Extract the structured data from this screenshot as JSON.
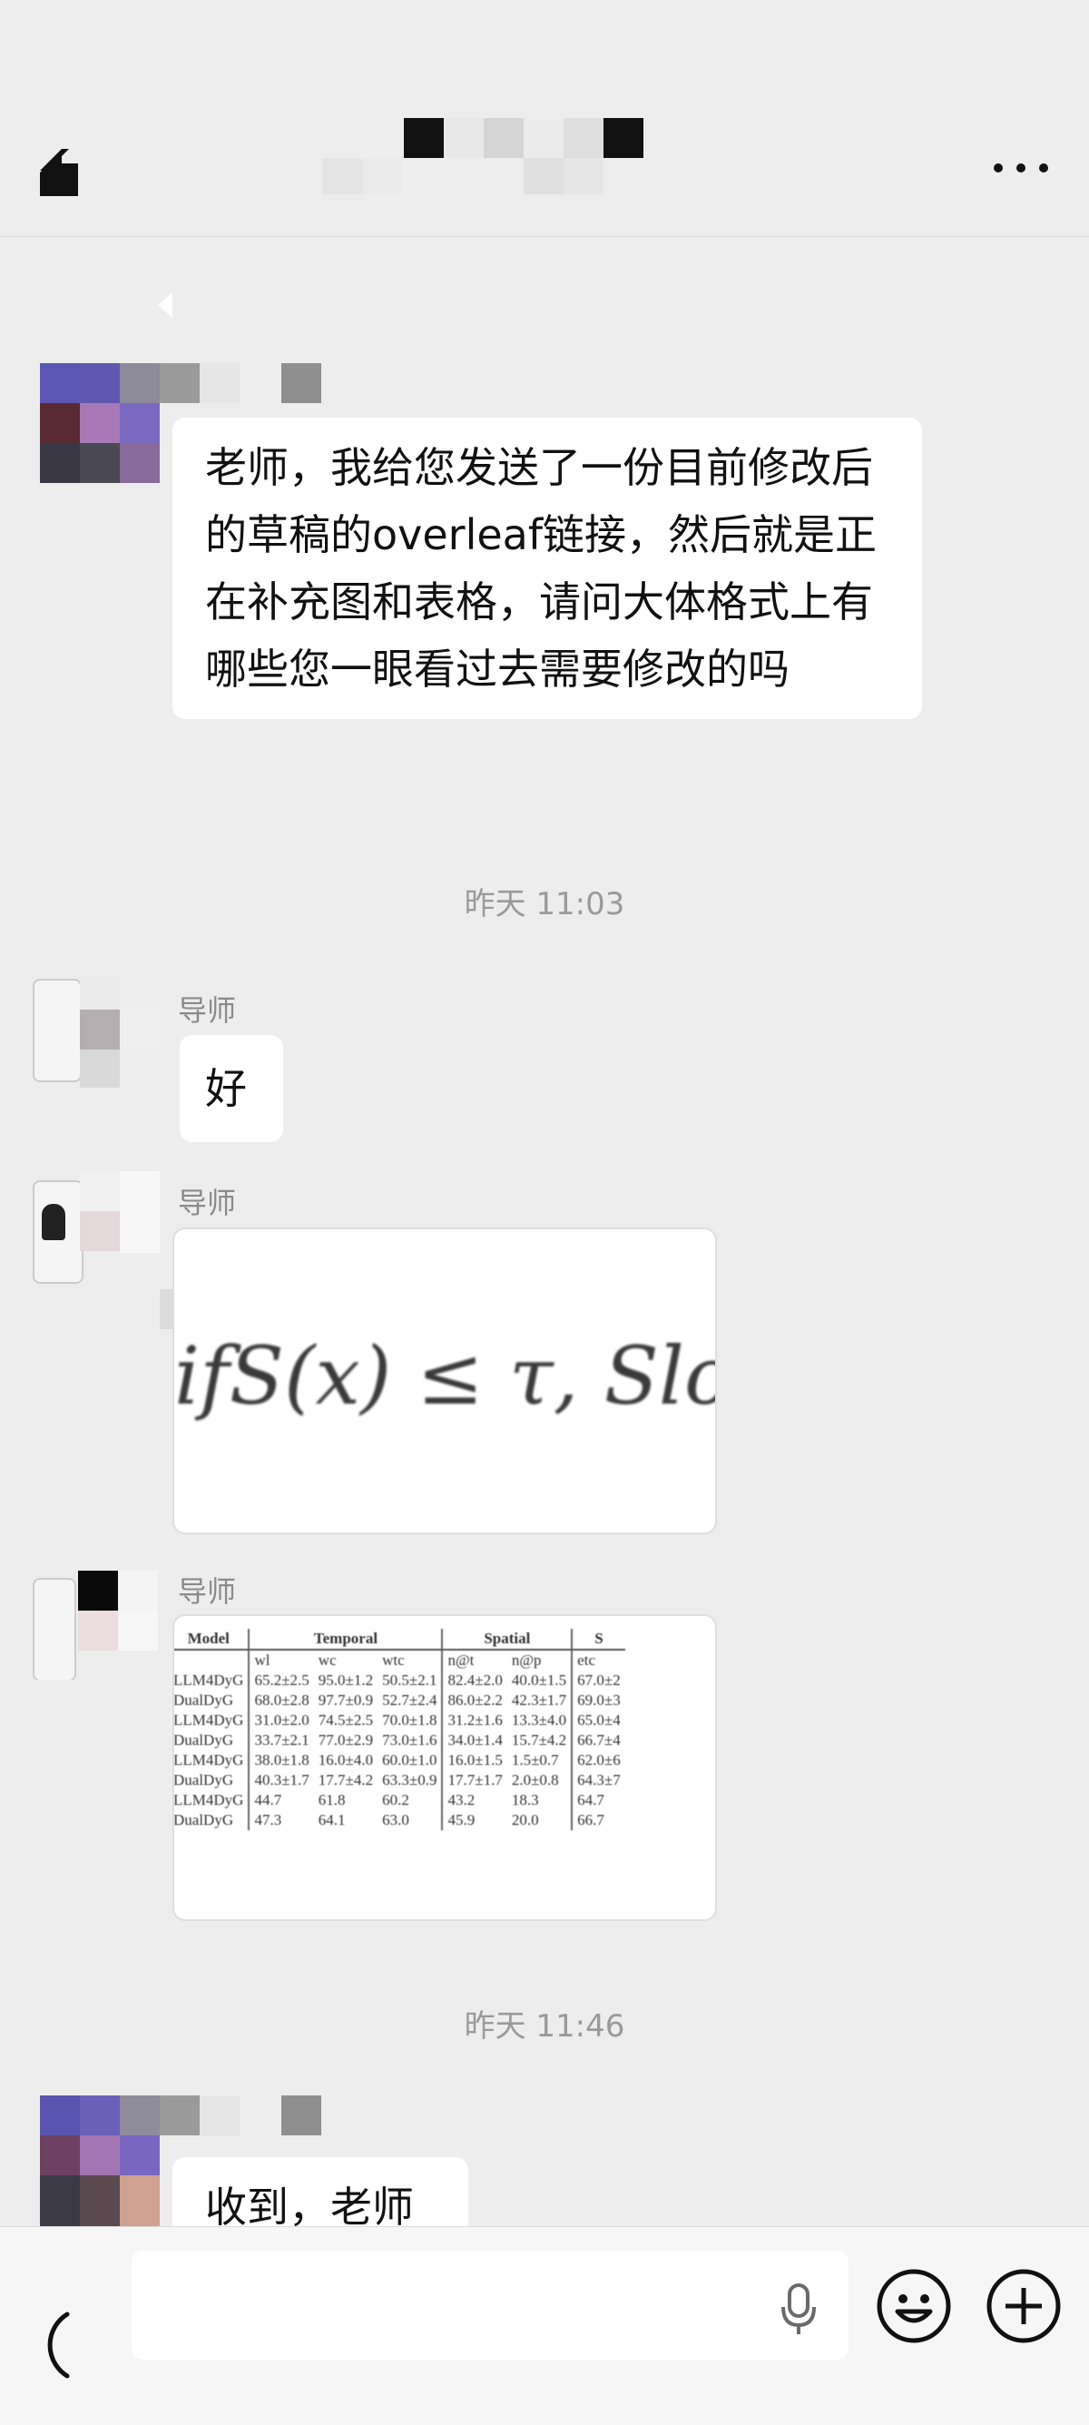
{
  "header": {
    "back_icon": "back-chevron-icon",
    "more_icon": "more-dots-icon",
    "more_label": "···"
  },
  "messages": [
    {
      "text": "老师，我给您发送了一份目前修改后的草稿的overleaf链接，然后就是正在补充图和表格，请问大体格式上有哪些您一眼看过去需要修改的吗"
    },
    {
      "timestamp": "昨天 11:03"
    },
    {
      "sender": "导师",
      "text": "好"
    },
    {
      "sender": "导师",
      "image_formula": "ifS(x) ≤ τ, Slo"
    },
    {
      "sender": "导师",
      "image": "table"
    },
    {
      "timestamp": "昨天 11:46"
    },
    {
      "text": "收到，老师"
    }
  ],
  "table": {
    "groups": [
      "Model",
      "Temporal",
      "Spatial",
      "S"
    ],
    "subheaders": [
      "",
      "wl",
      "wc",
      "wtc",
      "n@t",
      "n@p",
      "etc"
    ],
    "rows": [
      [
        "LLM4DyG",
        "65.2±2.5",
        "95.0±1.2",
        "50.5±2.1",
        "82.4±2.0",
        "40.0±1.5",
        "67.0±2"
      ],
      [
        "DualDyG",
        "68.0±2.8",
        "97.7±0.9",
        "52.7±2.4",
        "86.0±2.2",
        "42.3±1.7",
        "69.0±3"
      ],
      [
        "LLM4DyG",
        "31.0±2.0",
        "74.5±2.5",
        "70.0±1.8",
        "31.2±1.6",
        "13.3±4.0",
        "65.0±4"
      ],
      [
        "DualDyG",
        "33.7±2.1",
        "77.0±2.9",
        "73.0±1.6",
        "34.0±1.4",
        "15.7±4.2",
        "66.7±4"
      ],
      [
        "LLM4DyG",
        "38.0±1.8",
        "16.0±4.0",
        "60.0±1.0",
        "16.0±1.5",
        "1.5±0.7",
        "62.0±6"
      ],
      [
        "DualDyG",
        "40.3±1.7",
        "17.7±4.2",
        "63.3±0.9",
        "17.7±1.7",
        "2.0±0.8",
        "64.3±7"
      ],
      [
        "LLM4DyG",
        "44.7",
        "61.8",
        "60.2",
        "43.2",
        "18.3",
        "64.7"
      ],
      [
        "DualDyG",
        "47.3",
        "64.1",
        "63.0",
        "45.9",
        "20.0",
        "66.7"
      ]
    ]
  },
  "input": {
    "placeholder": "",
    "voice_icon": "voice-mode-icon",
    "mic_icon": "microphone-icon",
    "emoji_icon": "emoji-icon",
    "plus_icon": "plus-icon"
  },
  "colors": {
    "background": "#ededed",
    "bubble": "#ffffff",
    "secondary_text": "#8a8a8a"
  }
}
